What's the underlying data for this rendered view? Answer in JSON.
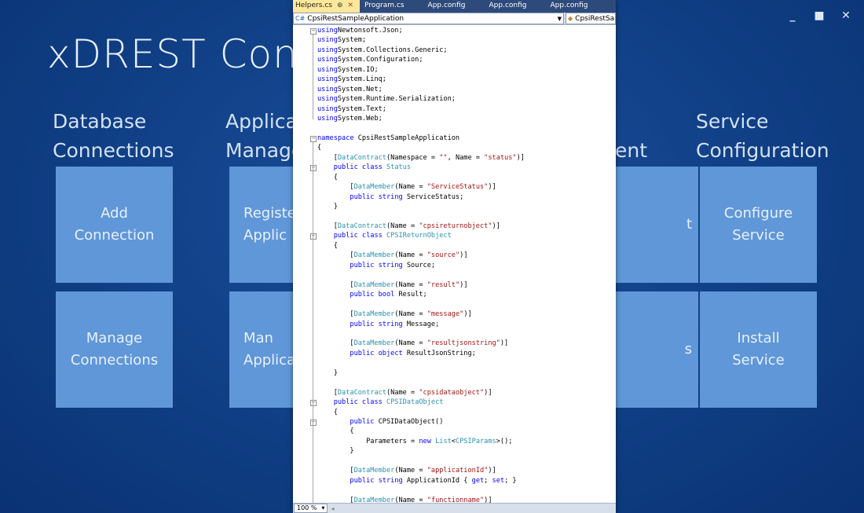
{
  "app": {
    "title": "xDREST Console",
    "window_controls": {
      "minimize": "_",
      "maximize": "■",
      "close": "✕"
    }
  },
  "groups": [
    {
      "title": "Database\nConnections",
      "tiles": [
        "Add\nConnection",
        "Manage\nConnections"
      ]
    },
    {
      "title": "Applica\nManage",
      "tiles": [
        "Registe\nApplic",
        "Man\nApplica"
      ]
    },
    {
      "title": "ent",
      "tiles": [
        "t",
        "s"
      ]
    },
    {
      "title": "Service\nConfiguration",
      "tiles": [
        "Configure\nService",
        "Install\nService"
      ]
    }
  ],
  "editor": {
    "tabs": [
      {
        "label": "Helpers.cs",
        "pin": "⊕",
        "close": "✕",
        "active": true
      },
      {
        "label": "Program.cs"
      },
      {
        "label": "App.config"
      },
      {
        "label": "App.config"
      },
      {
        "label": "App.config"
      }
    ],
    "nav_left": "CpsiRestSampleApplication",
    "nav_right": "CpsiRestSam",
    "zoom": "100 %",
    "lines": [
      [
        [
          "kw",
          "using"
        ],
        [
          "",
          "Newtonsoft.Json;"
        ]
      ],
      [
        [
          "kw",
          "using"
        ],
        [
          "",
          "System;"
        ]
      ],
      [
        [
          "kw",
          "using"
        ],
        [
          "",
          "System.Collections.Generic;"
        ]
      ],
      [
        [
          "kw",
          "using"
        ],
        [
          "",
          "System.Configuration;"
        ]
      ],
      [
        [
          "kw",
          "using"
        ],
        [
          "",
          "System.IO;"
        ]
      ],
      [
        [
          "kw",
          "using"
        ],
        [
          "",
          "System.Linq;"
        ]
      ],
      [
        [
          "kw",
          "using"
        ],
        [
          "",
          "System.Net;"
        ]
      ],
      [
        [
          "kw",
          "using"
        ],
        [
          "",
          "System.Runtime.Serialization;"
        ]
      ],
      [
        [
          "kw",
          "using"
        ],
        [
          "",
          "System.Text;"
        ]
      ],
      [
        [
          "kw",
          "using"
        ],
        [
          "",
          "System.Web;"
        ]
      ],
      [],
      [
        [
          "kw",
          "namespace"
        ],
        [
          "",
          " CpsiRestSampleApplication"
        ]
      ],
      [
        [
          "",
          "{"
        ]
      ],
      [
        [
          "",
          "    ["
        ],
        [
          "ty",
          "DataContract"
        ],
        [
          "",
          "(Namespace = "
        ],
        [
          "st",
          "\"\""
        ],
        [
          "",
          ", Name = "
        ],
        [
          "st",
          "\"status\""
        ],
        [
          "",
          ")]"
        ]
      ],
      [
        [
          "",
          "    "
        ],
        [
          "kw",
          "public class"
        ],
        [
          "",
          " "
        ],
        [
          "ty",
          "Status"
        ]
      ],
      [
        [
          "",
          "    {"
        ]
      ],
      [
        [
          "",
          "        ["
        ],
        [
          "ty",
          "DataMember"
        ],
        [
          "",
          "(Name = "
        ],
        [
          "st",
          "\"ServiceStatus\""
        ],
        [
          "",
          ")]"
        ]
      ],
      [
        [
          "",
          "        "
        ],
        [
          "kw",
          "public string"
        ],
        [
          "",
          " ServiceStatus;"
        ]
      ],
      [
        [
          "",
          "    }"
        ]
      ],
      [],
      [
        [
          "",
          "    ["
        ],
        [
          "ty",
          "DataContract"
        ],
        [
          "",
          "(Name = "
        ],
        [
          "st",
          "\"cpsireturnobject\""
        ],
        [
          "",
          ")]"
        ]
      ],
      [
        [
          "",
          "    "
        ],
        [
          "kw",
          "public class"
        ],
        [
          "",
          " "
        ],
        [
          "ty",
          "CPSIReturnObject"
        ]
      ],
      [
        [
          "",
          "    {"
        ]
      ],
      [
        [
          "",
          "        ["
        ],
        [
          "ty",
          "DataMember"
        ],
        [
          "",
          "(Name = "
        ],
        [
          "st",
          "\"source\""
        ],
        [
          "",
          ")]"
        ]
      ],
      [
        [
          "",
          "        "
        ],
        [
          "kw",
          "public string"
        ],
        [
          "",
          " Source;"
        ]
      ],
      [],
      [
        [
          "",
          "        ["
        ],
        [
          "ty",
          "DataMember"
        ],
        [
          "",
          "(Name = "
        ],
        [
          "st",
          "\"result\""
        ],
        [
          "",
          ")]"
        ]
      ],
      [
        [
          "",
          "        "
        ],
        [
          "kw",
          "public bool"
        ],
        [
          "",
          " Result;"
        ]
      ],
      [],
      [
        [
          "",
          "        ["
        ],
        [
          "ty",
          "DataMember"
        ],
        [
          "",
          "(Name = "
        ],
        [
          "st",
          "\"message\""
        ],
        [
          "",
          ")]"
        ]
      ],
      [
        [
          "",
          "        "
        ],
        [
          "kw",
          "public string"
        ],
        [
          "",
          " Message;"
        ]
      ],
      [],
      [
        [
          "",
          "        ["
        ],
        [
          "ty",
          "DataMember"
        ],
        [
          "",
          "(Name = "
        ],
        [
          "st",
          "\"resultjsonstring\""
        ],
        [
          "",
          ")]"
        ]
      ],
      [
        [
          "",
          "        "
        ],
        [
          "kw",
          "public object"
        ],
        [
          "",
          " ResultJsonString;"
        ]
      ],
      [],
      [
        [
          "",
          "    }"
        ]
      ],
      [],
      [
        [
          "",
          "    ["
        ],
        [
          "ty",
          "DataContract"
        ],
        [
          "",
          "(Name = "
        ],
        [
          "st",
          "\"cpsidataobject\""
        ],
        [
          "",
          ")]"
        ]
      ],
      [
        [
          "",
          "    "
        ],
        [
          "kw",
          "public class"
        ],
        [
          "",
          " "
        ],
        [
          "ty",
          "CPSIDataObject"
        ]
      ],
      [
        [
          "",
          "    {"
        ]
      ],
      [
        [
          "",
          "        "
        ],
        [
          "kw",
          "public"
        ],
        [
          "",
          " CPSIDataObject()"
        ]
      ],
      [
        [
          "",
          "        {"
        ]
      ],
      [
        [
          "",
          "            Parameters = "
        ],
        [
          "kw",
          "new"
        ],
        [
          "",
          " "
        ],
        [
          "ty",
          "List"
        ],
        [
          "",
          "<"
        ],
        [
          "ty",
          "CPSIParams"
        ],
        [
          "",
          ">();"
        ]
      ],
      [
        [
          "",
          "        }"
        ]
      ],
      [],
      [
        [
          "",
          "        ["
        ],
        [
          "ty",
          "DataMember"
        ],
        [
          "",
          "(Name = "
        ],
        [
          "st",
          "\"applicationId\""
        ],
        [
          "",
          ")]"
        ]
      ],
      [
        [
          "",
          "        "
        ],
        [
          "kw",
          "public string"
        ],
        [
          "",
          " ApplicationId { "
        ],
        [
          "kw",
          "get"
        ],
        [
          "",
          "; "
        ],
        [
          "kw",
          "set"
        ],
        [
          "",
          "; }"
        ]
      ],
      [],
      [
        [
          "",
          "        ["
        ],
        [
          "ty",
          "DataMember"
        ],
        [
          "",
          "(Name = "
        ],
        [
          "st",
          "\"functionname\""
        ],
        [
          "",
          ")]"
        ]
      ]
    ]
  }
}
